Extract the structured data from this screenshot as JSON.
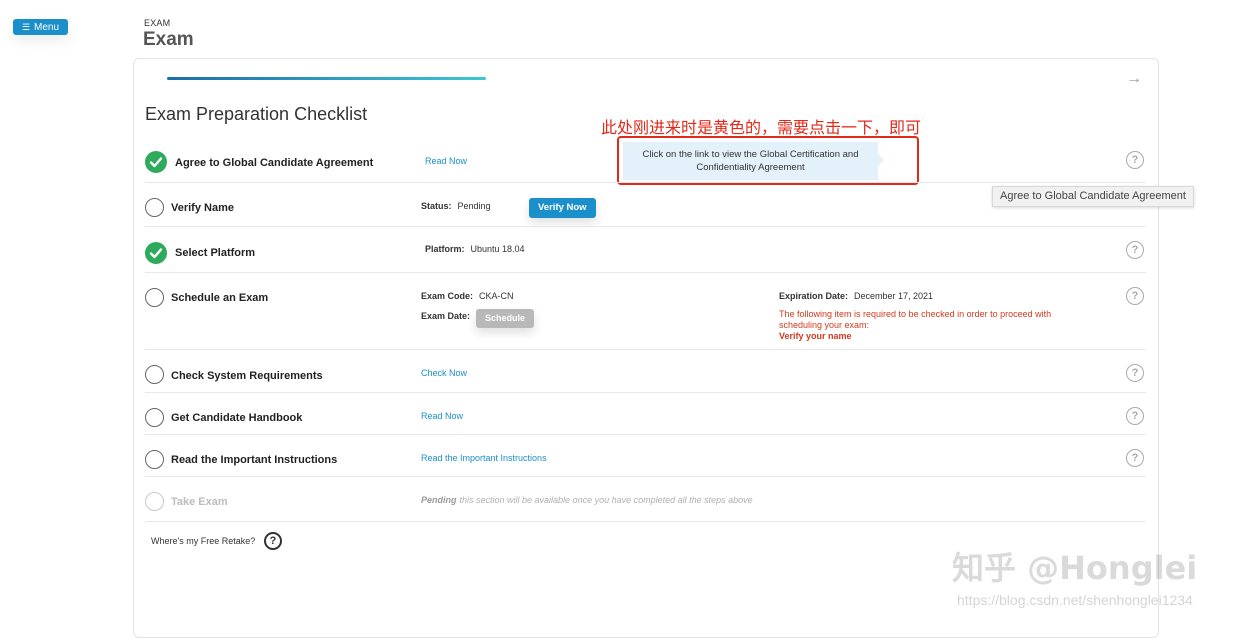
{
  "nav": {
    "menu_label": "Menu"
  },
  "header": {
    "breadcrumb": "EXAM",
    "title": "Exam"
  },
  "checklist": {
    "title": "Exam Preparation Checklist",
    "progress_fraction": 0.31
  },
  "annotation_text": "此处刚进来时是黄色的，需要点击一下，即可",
  "tooltip_text": "Click on the link to view the Global Certification and Confidentiality Agreement",
  "hover_tooltip": "Agree to Global Candidate Agreement",
  "steps": {
    "agreement": {
      "label": "Agree to Global Candidate Agreement",
      "link": "Read Now",
      "done": true
    },
    "verify_name": {
      "label": "Verify Name",
      "status_label": "Status:",
      "status_value": "Pending",
      "button": "Verify Now",
      "done": false
    },
    "platform": {
      "label": "Select Platform",
      "platform_label": "Platform:",
      "platform_value": "Ubuntu 18.04",
      "done": true
    },
    "schedule": {
      "label": "Schedule an Exam",
      "exam_code_label": "Exam Code:",
      "exam_code_value": "CKA-CN",
      "exam_date_label": "Exam Date:",
      "schedule_button": "Schedule",
      "expiration_label": "Expiration Date:",
      "expiration_value": "December 17, 2021",
      "warning": "The following item is required to be checked in order to proceed with scheduling your exam:",
      "warning_item": "Verify your name",
      "done": false
    },
    "system": {
      "label": "Check System Requirements",
      "link": "Check Now",
      "done": false
    },
    "handbook": {
      "label": "Get Candidate Handbook",
      "link": "Read Now",
      "done": false
    },
    "instructions": {
      "label": "Read the Important Instructions",
      "link": "Read the Important Instructions",
      "done": false
    },
    "take_exam": {
      "label": "Take Exam",
      "pending_label": "Pending",
      "pending_text": "this section will be available once you have completed all the steps above",
      "done": false
    }
  },
  "footer": {
    "retake_text": "Where's my Free Retake?"
  },
  "watermark": {
    "brand": "知乎 @Honglei",
    "url": "https://blog.csdn.net/shenhonglei1234"
  },
  "colors": {
    "accent": "#1a8fc9",
    "success": "#2eaa5c",
    "warning": "#d03a1f",
    "annotation": "#e02a1a"
  }
}
